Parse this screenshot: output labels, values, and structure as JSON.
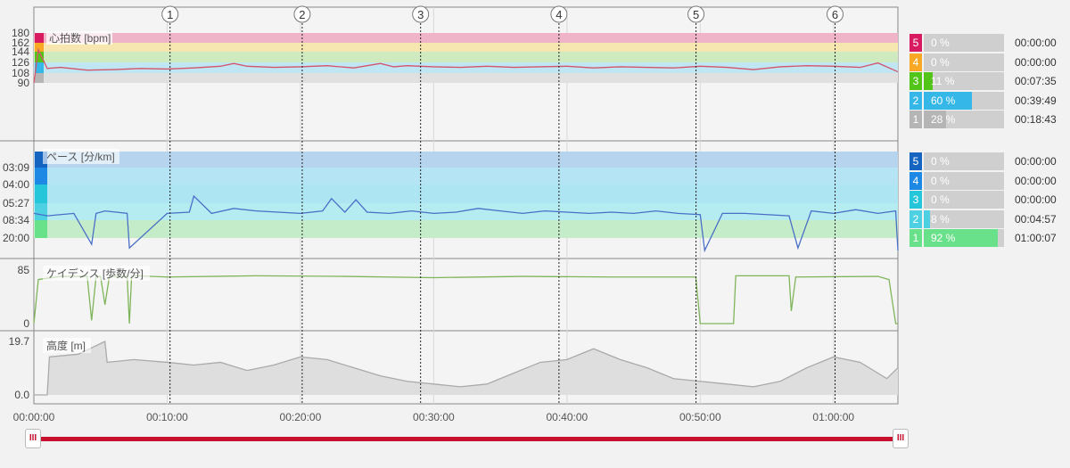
{
  "chart_data": {
    "type": "line",
    "x_axis": {
      "ticks": [
        "00:00:00",
        "00:10:00",
        "00:20:00",
        "00:30:00",
        "00:40:00",
        "00:50:00",
        "01:00:00"
      ],
      "range_seconds": [
        0,
        3890
      ]
    },
    "markers": [
      {
        "label": "1",
        "t": 613
      },
      {
        "label": "2",
        "t": 1208
      },
      {
        "label": "3",
        "t": 1741
      },
      {
        "label": "4",
        "t": 2364
      },
      {
        "label": "5",
        "t": 2981
      },
      {
        "label": "6",
        "t": 3607
      }
    ],
    "panels": [
      {
        "id": "hr",
        "title": "心拍数 [bpm]",
        "y_ticks": [
          "180",
          "162",
          "144",
          "126",
          "108",
          "90"
        ],
        "ylim": [
          90,
          180
        ],
        "color": "#d4546a",
        "x": [
          0,
          20,
          60,
          120,
          240,
          360,
          480,
          600,
          720,
          840,
          900,
          960,
          1080,
          1200,
          1320,
          1440,
          1560,
          1620,
          1680,
          1800,
          1920,
          2040,
          2160,
          2280,
          2400,
          2520,
          2640,
          2760,
          2880,
          3000,
          3120,
          3240,
          3360,
          3480,
          3600,
          3720,
          3800,
          3890
        ],
        "y": [
          90,
          150,
          116,
          118,
          113,
          114,
          116,
          115,
          117,
          120,
          125,
          120,
          118,
          119,
          121,
          117,
          125,
          119,
          121,
          119,
          118,
          120,
          118,
          119,
          120,
          117,
          119,
          118,
          117,
          120,
          118,
          114,
          119,
          121,
          120,
          118,
          126,
          110
        ]
      },
      {
        "id": "pace",
        "title": "ペース [分/km]",
        "y_ticks": [
          "03:09",
          "04:00",
          "05:27",
          "08:34",
          "20:00"
        ],
        "color": "#4a6fc7",
        "x": [
          0,
          60,
          180,
          260,
          280,
          320,
          420,
          430,
          600,
          700,
          720,
          800,
          900,
          1000,
          1100,
          1200,
          1300,
          1340,
          1400,
          1450,
          1500,
          1600,
          1700,
          1800,
          1900,
          2000,
          2100,
          2200,
          2300,
          2400,
          2500,
          2600,
          2700,
          2800,
          2900,
          3000,
          3020,
          3100,
          3200,
          3400,
          3440,
          3500,
          3600,
          3700,
          3800,
          3880,
          3890
        ],
        "y": [
          9.0,
          9.2,
          9.0,
          11.5,
          9.0,
          8.8,
          9.0,
          11.8,
          9.0,
          8.9,
          7.6,
          9.0,
          8.6,
          8.8,
          8.9,
          9.0,
          8.8,
          7.8,
          8.9,
          7.9,
          8.9,
          9.0,
          8.8,
          9.0,
          8.9,
          8.6,
          8.8,
          9.0,
          8.8,
          8.9,
          9.0,
          8.9,
          9.0,
          8.8,
          9.0,
          9.1,
          12.0,
          9.0,
          9.0,
          9.2,
          11.8,
          8.8,
          9.0,
          8.7,
          9.0,
          8.8,
          12.0
        ]
      },
      {
        "id": "cadence",
        "title": "ケイデンス [歩数/分]",
        "y_ticks": [
          "85",
          "0"
        ],
        "ylim": [
          0,
          85
        ],
        "color": "#7fb55a",
        "x": [
          0,
          20,
          120,
          240,
          260,
          280,
          300,
          320,
          340,
          420,
          430,
          440,
          460,
          600,
          1000,
          1400,
          1800,
          2200,
          2600,
          2980,
          3000,
          3150,
          3160,
          3400,
          3410,
          3430,
          3800,
          3850,
          3880,
          3890
        ],
        "y": [
          0,
          70,
          75,
          75,
          5,
          75,
          75,
          30,
          75,
          75,
          0,
          75,
          76,
          74,
          76,
          75,
          73,
          75,
          74,
          74,
          0,
          0,
          76,
          76,
          20,
          74,
          75,
          70,
          0,
          0
        ]
      },
      {
        "id": "altitude",
        "title": "高度 [m]",
        "y_ticks": [
          "19.7",
          "0.0"
        ],
        "ylim": [
          0,
          19.7
        ],
        "color": "#aaaaaa",
        "x": [
          0,
          60,
          70,
          200,
          320,
          330,
          450,
          600,
          720,
          840,
          960,
          1080,
          1200,
          1320,
          1440,
          1560,
          1680,
          1800,
          1920,
          2040,
          2160,
          2280,
          2400,
          2520,
          2640,
          2760,
          2880,
          3000,
          3120,
          3240,
          3360,
          3480,
          3600,
          3720,
          3840,
          3890
        ],
        "y": [
          0,
          0,
          14,
          15,
          19.7,
          12,
          13,
          12,
          11,
          12,
          9,
          11,
          14,
          13,
          10,
          7,
          5,
          4,
          3,
          4,
          8,
          12,
          13,
          17,
          13,
          10,
          6,
          5,
          4,
          3,
          5,
          10,
          14,
          12,
          6,
          10
        ]
      }
    ]
  },
  "hr_zones": [
    {
      "zone": "5",
      "pct": "0 %",
      "pct_value": 0,
      "time": "00:00:00",
      "color": "#d81b60"
    },
    {
      "zone": "4",
      "pct": "0 %",
      "pct_value": 0,
      "time": "00:00:00",
      "color": "#f9a825"
    },
    {
      "zone": "3",
      "pct": "11 %",
      "pct_value": 11,
      "time": "00:07:35",
      "color": "#52c41a"
    },
    {
      "zone": "2",
      "pct": "60 %",
      "pct_value": 60,
      "time": "00:39:49",
      "color": "#35b7e8"
    },
    {
      "zone": "1",
      "pct": "28 %",
      "pct_value": 28,
      "time": "00:18:43",
      "color": "#b5b5b5"
    }
  ],
  "pace_zones": [
    {
      "zone": "5",
      "pct": "0 %",
      "pct_value": 0,
      "time": "00:00:00",
      "color": "#1565c0"
    },
    {
      "zone": "4",
      "pct": "0 %",
      "pct_value": 0,
      "time": "00:00:00",
      "color": "#1e88e5"
    },
    {
      "zone": "3",
      "pct": "0 %",
      "pct_value": 0,
      "time": "00:00:00",
      "color": "#26c6da"
    },
    {
      "zone": "2",
      "pct": "8 %",
      "pct_value": 8,
      "time": "00:04:57",
      "color": "#4dd0e1"
    },
    {
      "zone": "1",
      "pct": "92 %",
      "pct_value": 92,
      "time": "01:00:07",
      "color": "#69e08a"
    }
  ],
  "range_slider": {
    "start_glyph": "III",
    "end_glyph": "III",
    "color": "#c8102e"
  }
}
